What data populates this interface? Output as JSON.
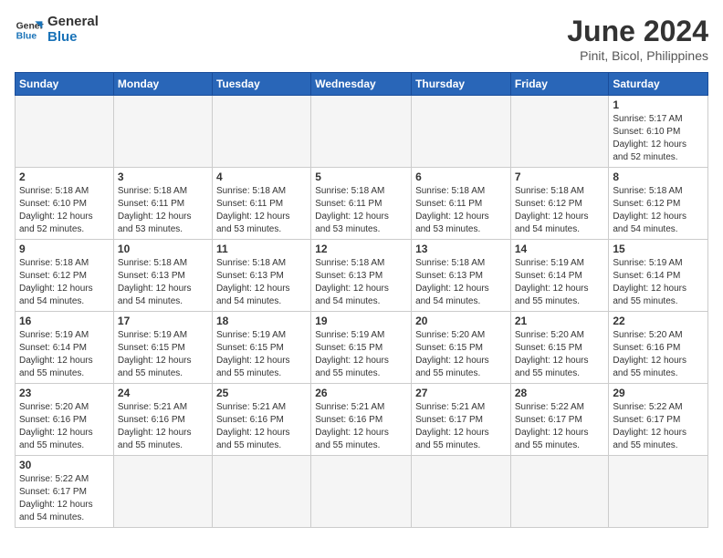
{
  "header": {
    "logo_general": "General",
    "logo_blue": "Blue",
    "month_year": "June 2024",
    "location": "Pinit, Bicol, Philippines"
  },
  "weekdays": [
    "Sunday",
    "Monday",
    "Tuesday",
    "Wednesday",
    "Thursday",
    "Friday",
    "Saturday"
  ],
  "weeks": [
    [
      {
        "day": "",
        "info": ""
      },
      {
        "day": "",
        "info": ""
      },
      {
        "day": "",
        "info": ""
      },
      {
        "day": "",
        "info": ""
      },
      {
        "day": "",
        "info": ""
      },
      {
        "day": "",
        "info": ""
      },
      {
        "day": "1",
        "info": "Sunrise: 5:17 AM\nSunset: 6:10 PM\nDaylight: 12 hours\nand 52 minutes."
      }
    ],
    [
      {
        "day": "2",
        "info": "Sunrise: 5:18 AM\nSunset: 6:10 PM\nDaylight: 12 hours\nand 52 minutes."
      },
      {
        "day": "3",
        "info": "Sunrise: 5:18 AM\nSunset: 6:11 PM\nDaylight: 12 hours\nand 53 minutes."
      },
      {
        "day": "4",
        "info": "Sunrise: 5:18 AM\nSunset: 6:11 PM\nDaylight: 12 hours\nand 53 minutes."
      },
      {
        "day": "5",
        "info": "Sunrise: 5:18 AM\nSunset: 6:11 PM\nDaylight: 12 hours\nand 53 minutes."
      },
      {
        "day": "6",
        "info": "Sunrise: 5:18 AM\nSunset: 6:11 PM\nDaylight: 12 hours\nand 53 minutes."
      },
      {
        "day": "7",
        "info": "Sunrise: 5:18 AM\nSunset: 6:12 PM\nDaylight: 12 hours\nand 54 minutes."
      },
      {
        "day": "8",
        "info": "Sunrise: 5:18 AM\nSunset: 6:12 PM\nDaylight: 12 hours\nand 54 minutes."
      }
    ],
    [
      {
        "day": "9",
        "info": "Sunrise: 5:18 AM\nSunset: 6:12 PM\nDaylight: 12 hours\nand 54 minutes."
      },
      {
        "day": "10",
        "info": "Sunrise: 5:18 AM\nSunset: 6:13 PM\nDaylight: 12 hours\nand 54 minutes."
      },
      {
        "day": "11",
        "info": "Sunrise: 5:18 AM\nSunset: 6:13 PM\nDaylight: 12 hours\nand 54 minutes."
      },
      {
        "day": "12",
        "info": "Sunrise: 5:18 AM\nSunset: 6:13 PM\nDaylight: 12 hours\nand 54 minutes."
      },
      {
        "day": "13",
        "info": "Sunrise: 5:18 AM\nSunset: 6:13 PM\nDaylight: 12 hours\nand 54 minutes."
      },
      {
        "day": "14",
        "info": "Sunrise: 5:19 AM\nSunset: 6:14 PM\nDaylight: 12 hours\nand 55 minutes."
      },
      {
        "day": "15",
        "info": "Sunrise: 5:19 AM\nSunset: 6:14 PM\nDaylight: 12 hours\nand 55 minutes."
      }
    ],
    [
      {
        "day": "16",
        "info": "Sunrise: 5:19 AM\nSunset: 6:14 PM\nDaylight: 12 hours\nand 55 minutes."
      },
      {
        "day": "17",
        "info": "Sunrise: 5:19 AM\nSunset: 6:15 PM\nDaylight: 12 hours\nand 55 minutes."
      },
      {
        "day": "18",
        "info": "Sunrise: 5:19 AM\nSunset: 6:15 PM\nDaylight: 12 hours\nand 55 minutes."
      },
      {
        "day": "19",
        "info": "Sunrise: 5:19 AM\nSunset: 6:15 PM\nDaylight: 12 hours\nand 55 minutes."
      },
      {
        "day": "20",
        "info": "Sunrise: 5:20 AM\nSunset: 6:15 PM\nDaylight: 12 hours\nand 55 minutes."
      },
      {
        "day": "21",
        "info": "Sunrise: 5:20 AM\nSunset: 6:15 PM\nDaylight: 12 hours\nand 55 minutes."
      },
      {
        "day": "22",
        "info": "Sunrise: 5:20 AM\nSunset: 6:16 PM\nDaylight: 12 hours\nand 55 minutes."
      }
    ],
    [
      {
        "day": "23",
        "info": "Sunrise: 5:20 AM\nSunset: 6:16 PM\nDaylight: 12 hours\nand 55 minutes."
      },
      {
        "day": "24",
        "info": "Sunrise: 5:21 AM\nSunset: 6:16 PM\nDaylight: 12 hours\nand 55 minutes."
      },
      {
        "day": "25",
        "info": "Sunrise: 5:21 AM\nSunset: 6:16 PM\nDaylight: 12 hours\nand 55 minutes."
      },
      {
        "day": "26",
        "info": "Sunrise: 5:21 AM\nSunset: 6:16 PM\nDaylight: 12 hours\nand 55 minutes."
      },
      {
        "day": "27",
        "info": "Sunrise: 5:21 AM\nSunset: 6:17 PM\nDaylight: 12 hours\nand 55 minutes."
      },
      {
        "day": "28",
        "info": "Sunrise: 5:22 AM\nSunset: 6:17 PM\nDaylight: 12 hours\nand 55 minutes."
      },
      {
        "day": "29",
        "info": "Sunrise: 5:22 AM\nSunset: 6:17 PM\nDaylight: 12 hours\nand 55 minutes."
      }
    ],
    [
      {
        "day": "30",
        "info": "Sunrise: 5:22 AM\nSunset: 6:17 PM\nDaylight: 12 hours\nand 54 minutes."
      },
      {
        "day": "",
        "info": ""
      },
      {
        "day": "",
        "info": ""
      },
      {
        "day": "",
        "info": ""
      },
      {
        "day": "",
        "info": ""
      },
      {
        "day": "",
        "info": ""
      },
      {
        "day": "",
        "info": ""
      }
    ]
  ]
}
